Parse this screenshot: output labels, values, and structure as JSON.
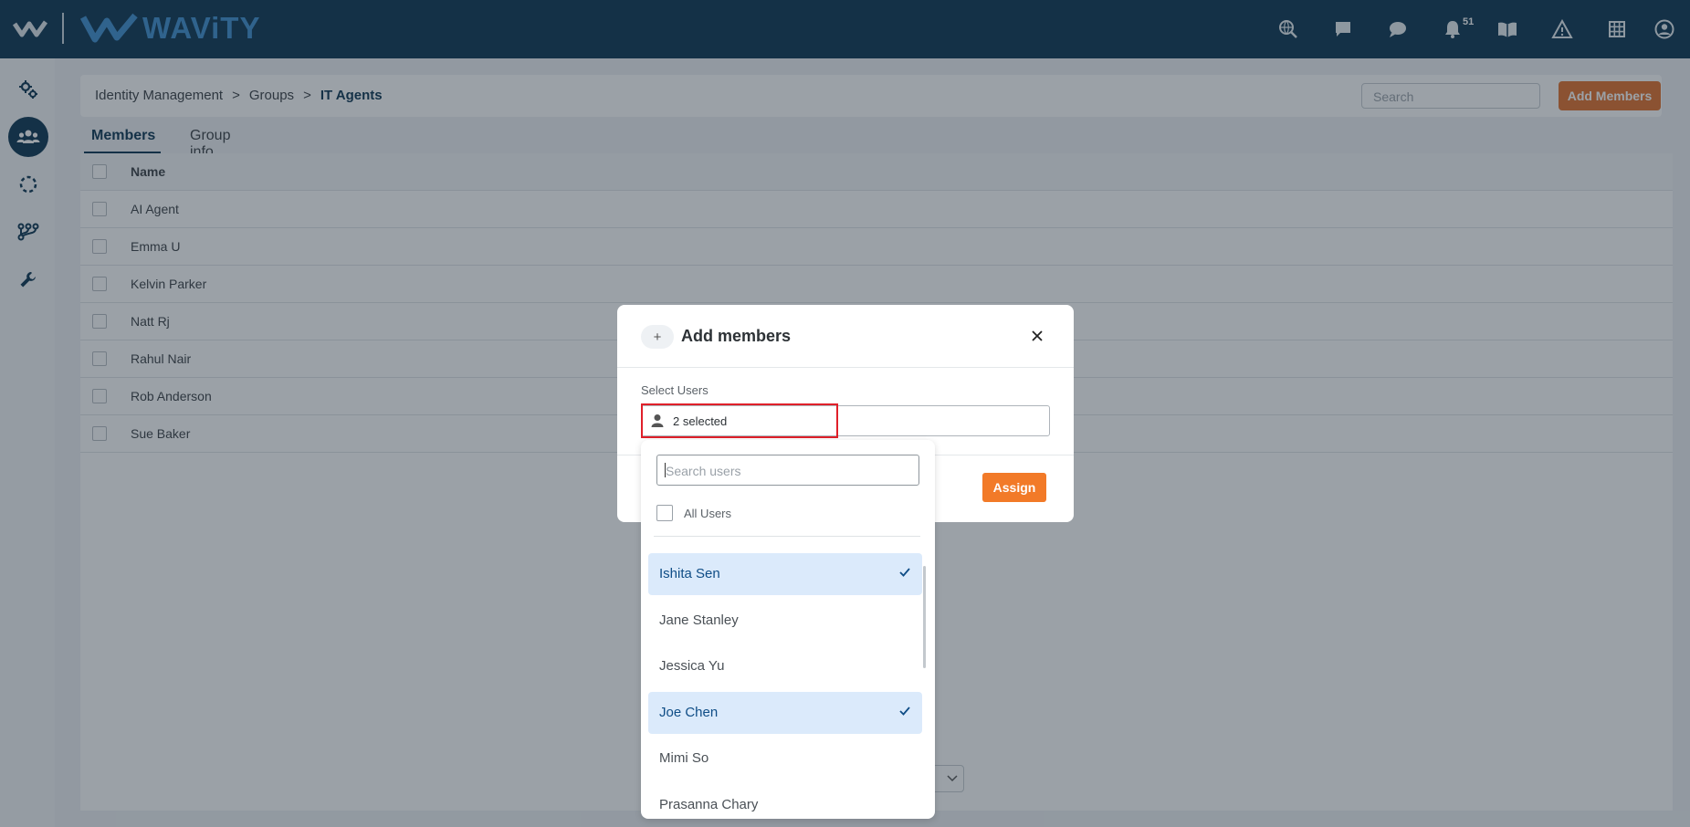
{
  "app": {
    "brand": "WAViTY"
  },
  "topbar": {
    "icons": [
      "search-globe-icon",
      "chat-icon",
      "comment-icon",
      "bell-icon",
      "book-icon",
      "warning-icon",
      "grid-icon",
      "user-icon"
    ],
    "notification_count": "51"
  },
  "sidebar": {
    "items": [
      "settings-icon",
      "groups-icon",
      "loading-icon",
      "workflow-icon",
      "wrench-icon"
    ]
  },
  "breadcrumb": {
    "items": [
      "Identity Management",
      "Groups"
    ],
    "separator": ">",
    "current": "IT Agents"
  },
  "header": {
    "search_placeholder": "Search",
    "add_members_label": "Add Members"
  },
  "tabs": [
    "Members",
    "Group info"
  ],
  "table": {
    "column_name": "Name",
    "rows": [
      "AI Agent",
      "Emma U",
      "Kelvin Parker",
      "Natt Rj",
      "Rahul Nair",
      "Rob Anderson",
      "Sue Baker"
    ]
  },
  "modal": {
    "plus": "+",
    "title": "Add members",
    "close": "×",
    "select_label": "Select Users",
    "selected_text": "2 selected",
    "assign_label": "Assign"
  },
  "dropdown": {
    "search_placeholder": "Search users",
    "all_users_label": "All Users",
    "options": [
      {
        "label": "Ishita Sen",
        "selected": true
      },
      {
        "label": "Jane Stanley",
        "selected": false
      },
      {
        "label": "Jessica Yu",
        "selected": false
      },
      {
        "label": "Joe Chen",
        "selected": true
      },
      {
        "label": "Mimi So",
        "selected": false
      },
      {
        "label": "Prasanna Chary",
        "selected": false
      }
    ]
  },
  "colors": {
    "topbar": "#0a3350",
    "brand_blue": "#3d8fd0",
    "accent_orange": "#e2702a",
    "selected_bg": "#dbeafb",
    "highlight_red": "#e0202a"
  }
}
